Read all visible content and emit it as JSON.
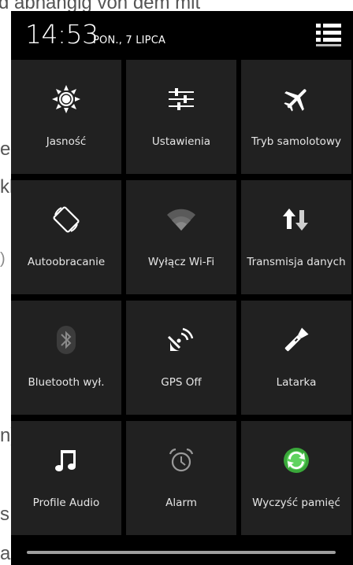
{
  "background": {
    "top_text": "d abhängig von dem mit",
    "er": "er",
    "klickt": "klickt",
    "paren": ")",
    "n_paren": "n)",
    "s": "s",
    "a": "a"
  },
  "status": {
    "time": "14:53",
    "date": "PON., 7 LIPCA",
    "menu_icon": "list-menu-icon"
  },
  "tiles": [
    {
      "label": "Jasność",
      "icon": "brightness-icon"
    },
    {
      "label": "Ustawienia",
      "icon": "settings-sliders-icon"
    },
    {
      "label": "Tryb samolotowy",
      "icon": "airplane-icon"
    },
    {
      "label": "Autoobracanie",
      "icon": "auto-rotate-icon"
    },
    {
      "label": "Wyłącz Wi-Fi",
      "icon": "wifi-icon"
    },
    {
      "label": "Transmisja danych",
      "icon": "data-transfer-icon"
    },
    {
      "label": "Bluetooth wył.",
      "icon": "bluetooth-icon"
    },
    {
      "label": "GPS Off",
      "icon": "gps-icon"
    },
    {
      "label": "Latarka",
      "icon": "flashlight-icon"
    },
    {
      "label": "Profile Audio",
      "icon": "music-note-icon"
    },
    {
      "label": "Alarm",
      "icon": "alarm-clock-icon"
    },
    {
      "label": "Wyczyść pamięć",
      "icon": "clear-memory-icon"
    }
  ],
  "colors": {
    "tile_bg": "#212121",
    "shade_bg": "#000000",
    "label": "#e6e6e6",
    "icon_white": "#ffffff",
    "icon_dim": "#6b6b6b",
    "clean_green": "#3aa83a"
  }
}
